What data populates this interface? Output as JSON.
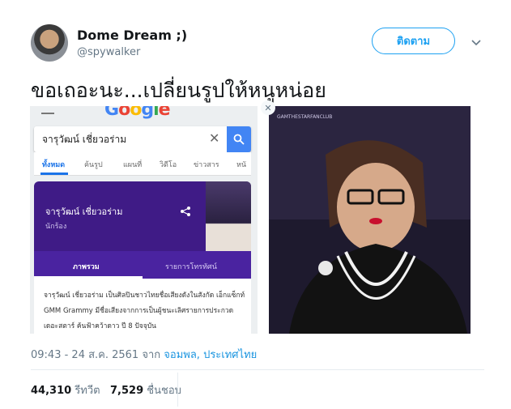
{
  "user": {
    "display_name": "Dome Dream ;)",
    "handle": "@spywalker",
    "follow_label": "ติดตาม"
  },
  "tweet": {
    "text": "ขอเถอะนะ...เปลี่ยนรูปให้หนูหน่อย",
    "timestamp": "09:43 - 24 ส.ค. 2561 จาก",
    "location": "จอมพล, ประเทศไทย",
    "retweets_count": "44,310",
    "retweets_label": "รีทวีต",
    "likes_count": "7,529",
    "likes_label": "ชื่นชอบ"
  },
  "screenshot_left": {
    "logo": "Google",
    "search_query": "จารุวัฒน์ เชี่ยวอร่าม",
    "tabs": [
      "ทั้งหมด",
      "ค้นรูป",
      "แผนที่",
      "วิดีโอ",
      "ข่าวสาร",
      "หนั"
    ],
    "knowledge_panel": {
      "title": "จารุวัฒน์ เชี่ยวอร่าม",
      "subtitle": "นักร้อง",
      "tab_overview": "ภาพรวม",
      "tab_shows": "รายการโทรทัศน์",
      "description": "จารุวัฒน์ เชี่ยวอร่าม เป็นศิลปินชาวไทยชื่อเสียงดังในสังกัด เอ็กแซ็กท์ GMM Grammy มีชื่อเสียงจากการเป็นผู้ชนะเลิศรายการประกวดเดอะสตาร์ ค้นฟ้าคว้าดาว ปี 8 ปัจจุบัน"
    }
  },
  "screenshot_right": {
    "watermark": "GAMTHESTARFANCLUB"
  },
  "colors": {
    "accent": "#1da1f2",
    "google_blue": "#4285f4",
    "kp_purple": "#3f1b86"
  }
}
